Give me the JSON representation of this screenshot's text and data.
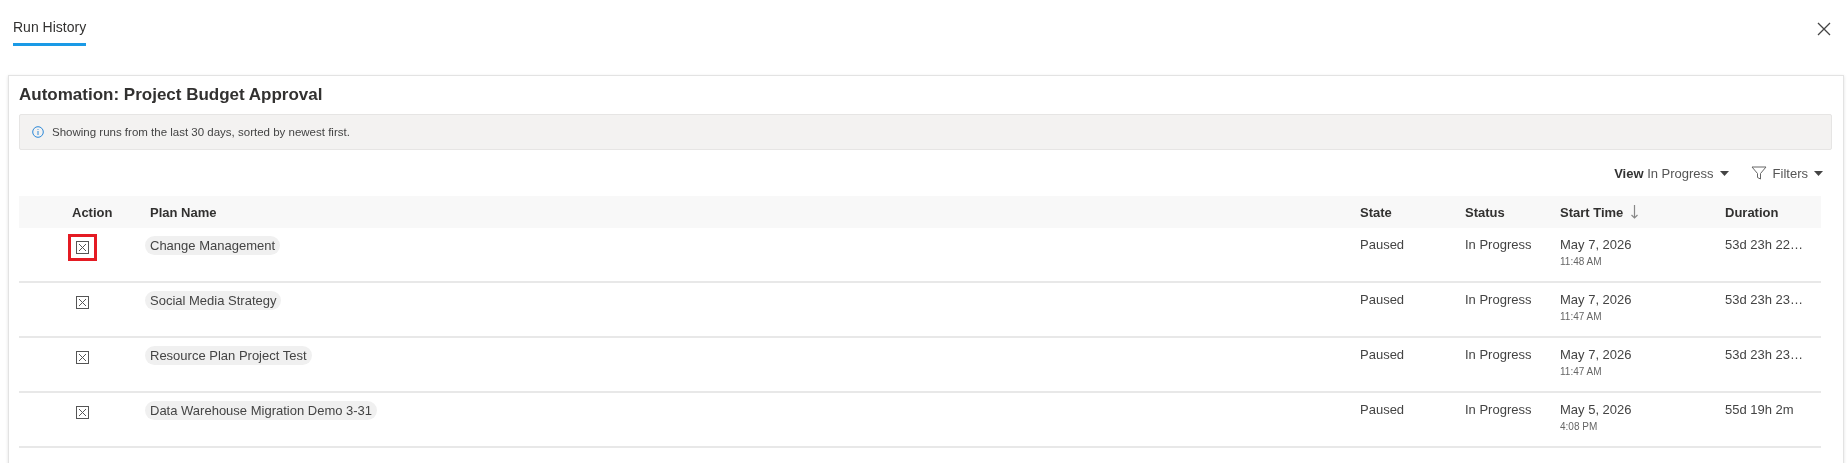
{
  "tabs": [
    {
      "label": "Run History",
      "selected": true
    }
  ],
  "card": {
    "title": "Automation: Project Budget Approval",
    "info": "Showing runs from the last 30 days, sorted by newest first."
  },
  "toolbar": {
    "view_label": "View",
    "view_value": "In Progress",
    "filters_label": "Filters"
  },
  "table": {
    "columns": [
      {
        "label": "Action",
        "sorted": false
      },
      {
        "label": "Plan Name",
        "sorted": false
      },
      {
        "label": "State",
        "sorted": false
      },
      {
        "label": "Status",
        "sorted": false
      },
      {
        "label": "Start Time",
        "sorted": true
      },
      {
        "label": "Duration",
        "sorted": false
      }
    ],
    "rows": [
      {
        "highlighted": true,
        "plan_name": "Change Management",
        "state": "Paused",
        "status": "In Progress",
        "start_date": "May 7, 2026",
        "start_time": "11:48 AM",
        "duration": "53d 23h 22…"
      },
      {
        "highlighted": false,
        "plan_name": "Social Media Strategy",
        "state": "Paused",
        "status": "In Progress",
        "start_date": "May 7, 2026",
        "start_time": "11:47 AM",
        "duration": "53d 23h 23…"
      },
      {
        "highlighted": false,
        "plan_name": "Resource Plan Project Test",
        "state": "Paused",
        "status": "In Progress",
        "start_date": "May 7, 2026",
        "start_time": "11:47 AM",
        "duration": "53d 23h 23…"
      },
      {
        "highlighted": false,
        "plan_name": "Data Warehouse Migration Demo 3-31",
        "state": "Paused",
        "status": "In Progress",
        "start_date": "May 5, 2026",
        "start_time": "4:08 PM",
        "duration": "55d 19h 2m"
      }
    ]
  }
}
